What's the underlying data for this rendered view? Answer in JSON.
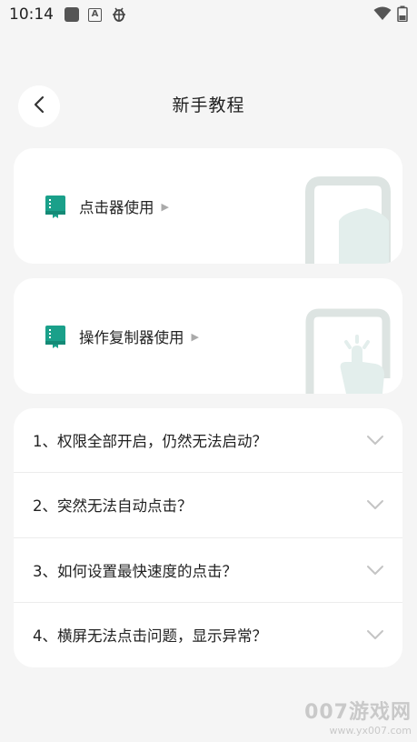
{
  "status_bar": {
    "time": "10:14",
    "icons": [
      "app-square-icon",
      "font-a-icon",
      "bug-icon",
      "wifi-icon",
      "battery-icon"
    ]
  },
  "header": {
    "title": "新手教程",
    "back_icon": "chevron-left-icon"
  },
  "cards": [
    {
      "label": "点击器使用",
      "icon": "book-icon",
      "art": "tablet-shield-art"
    },
    {
      "label": "操作复制器使用",
      "icon": "book-icon",
      "art": "tablet-finger-tap-art"
    }
  ],
  "faq": [
    {
      "question": "1、权限全部开启，仍然无法启动？"
    },
    {
      "question": "2、突然无法自动点击？"
    },
    {
      "question": "3、如何设置最快速度的点击？"
    },
    {
      "question": "4、横屏无法点击问题，显示异常？"
    }
  ],
  "watermark": {
    "title": "007游戏网",
    "url": "www.yx007.com"
  },
  "colors": {
    "accent": "#1aa08a",
    "background": "#f5f5f5",
    "card": "#ffffff"
  }
}
